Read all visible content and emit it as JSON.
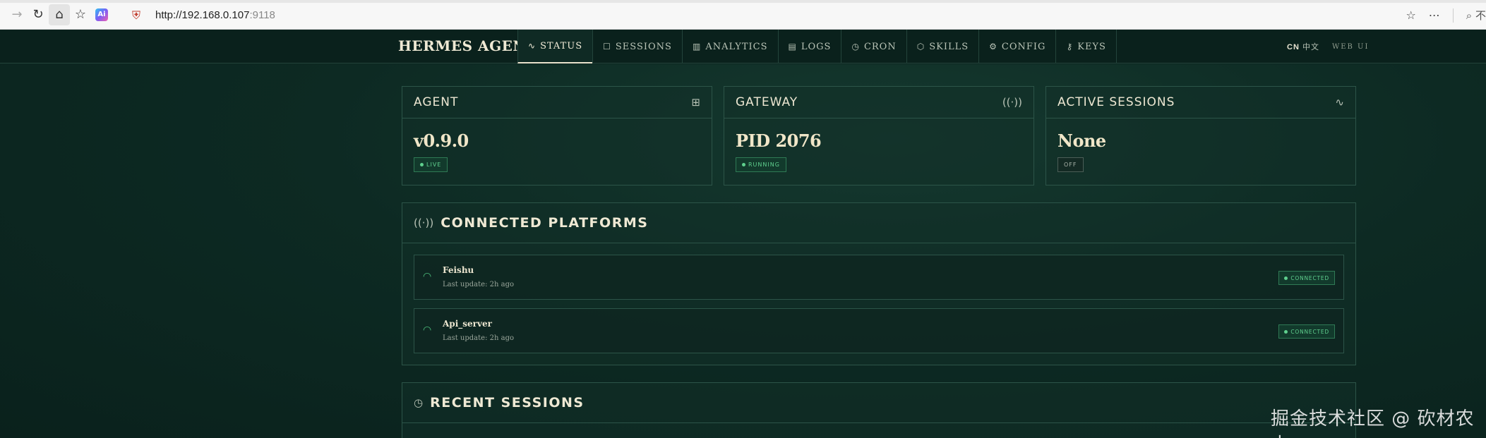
{
  "browser": {
    "url_host": "http://192.168.0.107",
    "url_port": ":9118",
    "search_cut": "不",
    "ai_label": "Ai"
  },
  "header": {
    "brand": "HERMES AGENT",
    "tabs": [
      {
        "label": "STATUS",
        "icon": "activity-icon"
      },
      {
        "label": "SESSIONS",
        "icon": "chat-icon"
      },
      {
        "label": "ANALYTICS",
        "icon": "bar-chart-icon"
      },
      {
        "label": "LOGS",
        "icon": "file-icon"
      },
      {
        "label": "CRON",
        "icon": "clock-icon"
      },
      {
        "label": "SKILLS",
        "icon": "package-icon"
      },
      {
        "label": "CONFIG",
        "icon": "gear-icon"
      },
      {
        "label": "KEYS",
        "icon": "key-icon"
      }
    ],
    "lang_cn": "CN",
    "lang_zh": "中文",
    "web_ui": "WEB UI"
  },
  "cards": {
    "agent": {
      "title": "AGENT",
      "value": "v0.9.0",
      "badge": "LIVE",
      "icon": "cpu-icon"
    },
    "gateway": {
      "title": "GATEWAY",
      "value": "PID 2076",
      "badge": "RUNNING",
      "icon": "radio-icon"
    },
    "sessions": {
      "title": "ACTIVE SESSIONS",
      "value": "None",
      "badge": "OFF",
      "icon": "activity-icon"
    }
  },
  "connected": {
    "title": "CONNECTED PLATFORMS",
    "platforms": [
      {
        "name": "Feishu",
        "sub": "Last update: 2h ago",
        "status": "CONNECTED"
      },
      {
        "name": "Api_server",
        "sub": "Last update: 2h ago",
        "status": "CONNECTED"
      }
    ]
  },
  "recent": {
    "title": "RECENT SESSIONS"
  },
  "watermark": "掘金技术社区 @ 砍材农夫",
  "colors": {
    "accent_green": "#5fd08e",
    "background": "#0c2620",
    "border": "#2c5448",
    "text_cream": "#f0e6c8"
  }
}
